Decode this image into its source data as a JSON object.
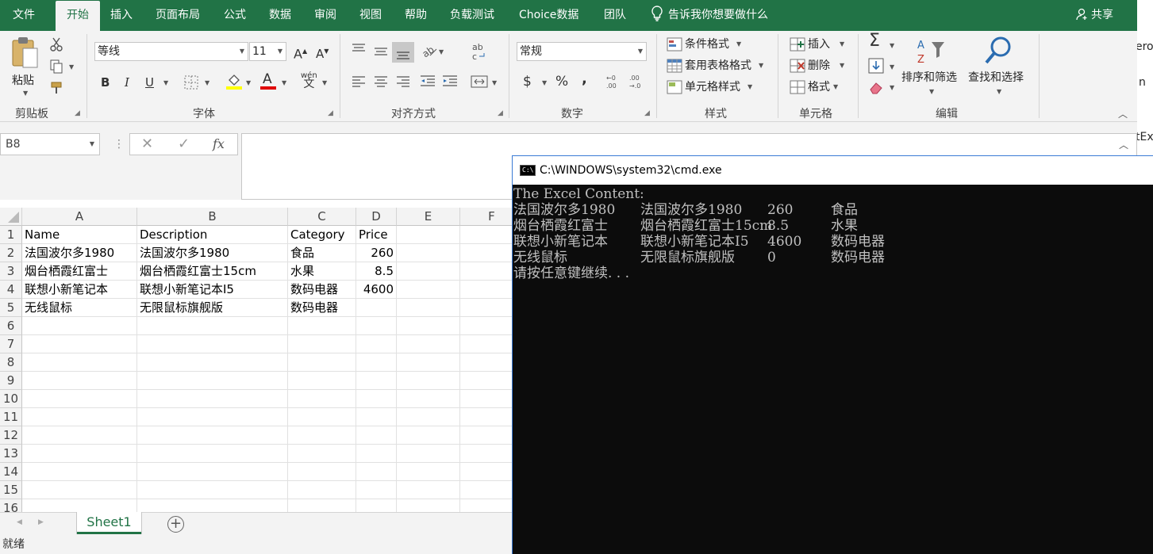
{
  "menubar": {
    "tabs": [
      "文件",
      "开始",
      "插入",
      "页面布局",
      "公式",
      "数据",
      "审阅",
      "视图",
      "帮助",
      "负载测试",
      "Choice数据",
      "团队"
    ],
    "tellme": "告诉我你想要做什么",
    "share": "共享"
  },
  "ribbon": {
    "clipboard": {
      "paste": "粘贴",
      "label": "剪贴板"
    },
    "font": {
      "name": "等线",
      "size": "11",
      "bold": "B",
      "italic": "I",
      "underline": "U",
      "grow": "A",
      "shrink": "A",
      "color_letter": "A",
      "phonetic": "wén",
      "label": "字体"
    },
    "alignment": {
      "label": "对齐方式"
    },
    "number": {
      "format": "常规",
      "currency": "$",
      "percent": "%",
      "comma": ",",
      "label": "数字"
    },
    "styles": {
      "conditional": "条件格式",
      "table": "套用表格格式",
      "cell": "单元格样式",
      "label": "样式"
    },
    "cells": {
      "insert": "插入",
      "delete": "删除",
      "format": "格式",
      "label": "单元格"
    },
    "editing": {
      "sum": "Σ",
      "sort": "排序和筛选",
      "find": "查找和选择",
      "label": "编辑"
    }
  },
  "right_strip": [
    "erop",
    "n",
    "tEx"
  ],
  "formula_bar": {
    "namebox": "B8",
    "fx": "fx",
    "value": ""
  },
  "sheet": {
    "columns": [
      "A",
      "B",
      "C",
      "D",
      "E",
      "F"
    ],
    "rows": [
      "1",
      "2",
      "3",
      "4",
      "5",
      "6",
      "7",
      "8",
      "9",
      "10",
      "11",
      "12",
      "13",
      "14",
      "15",
      "16"
    ],
    "cells": [
      [
        "Name",
        "Description",
        "Category",
        "Price"
      ],
      [
        "法国波尔多1980",
        "法国波尔多1980",
        "食品",
        "260"
      ],
      [
        "烟台栖霞红富士",
        "烟台栖霞红富士15cm",
        "水果",
        "8.5"
      ],
      [
        "联想小新笔记本",
        "联想小新笔记本I5",
        "数码电器",
        "4600"
      ],
      [
        "无线鼠标",
        "无限鼠标旗舰版",
        "数码电器",
        ""
      ]
    ]
  },
  "tabs": {
    "sheet1": "Sheet1",
    "add": "+"
  },
  "status": "就绪",
  "cmd": {
    "title": "C:\\WINDOWS\\system32\\cmd.exe",
    "icon_text": "C:\\",
    "header": "The Excel Content:",
    "rows": [
      [
        "法国波尔多1980",
        "法国波尔多1980",
        "260",
        "食品"
      ],
      [
        "烟台栖霞红富士",
        "烟台栖霞红富士15cm",
        "8.5",
        "水果"
      ],
      [
        "联想小新笔记本",
        "联想小新笔记本I5",
        "4600",
        "数码电器"
      ],
      [
        "无线鼠标",
        "无限鼠标旗舰版",
        "0",
        "数码电器"
      ]
    ],
    "prompt": "请按任意键继续. . ."
  },
  "colors": {
    "accent": "#217346",
    "ribbon_bg": "#f3f3f3",
    "console_bg": "#0c0c0c",
    "console_fg": "#c0c0c0"
  }
}
